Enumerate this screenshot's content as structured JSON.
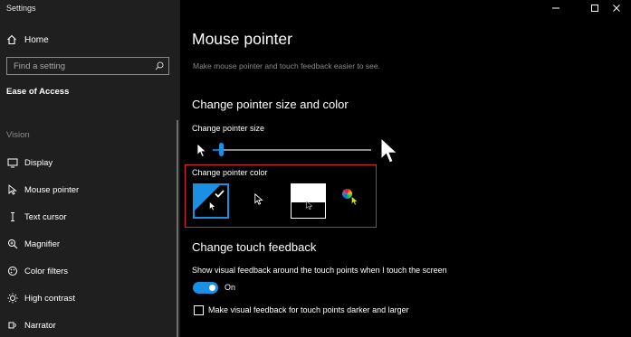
{
  "window": {
    "title": "Settings",
    "controls": [
      "minimize",
      "maximize",
      "close"
    ]
  },
  "sidebar": {
    "home_label": "Home",
    "search": {
      "placeholder": "Find a setting",
      "value": ""
    },
    "section_title": "Ease of Access",
    "group_label": "Vision",
    "items": [
      {
        "label": "Display",
        "icon": "display-icon"
      },
      {
        "label": "Mouse pointer",
        "icon": "mouse-pointer-icon"
      },
      {
        "label": "Text cursor",
        "icon": "text-cursor-icon"
      },
      {
        "label": "Magnifier",
        "icon": "magnifier-icon"
      },
      {
        "label": "Color filters",
        "icon": "color-filters-icon"
      },
      {
        "label": "High contrast",
        "icon": "high-contrast-icon"
      },
      {
        "label": "Narrator",
        "icon": "narrator-icon"
      }
    ]
  },
  "main": {
    "title": "Mouse pointer",
    "subtitle": "Make mouse pointer and touch feedback easier to see.",
    "size_color_heading": "Change pointer size and color",
    "pointer_size_label": "Change pointer size",
    "pointer_size_level": 0.05,
    "pointer_color_label": "Change pointer color",
    "pointer_color_options": [
      "white",
      "black",
      "inverted",
      "custom"
    ],
    "pointer_color_selected": "white",
    "touch_heading": "Change touch feedback",
    "touch_desc": "Show visual feedback around the touch points when I touch the screen",
    "toggle_state": "On",
    "darker_checkbox_label": "Make visual feedback for touch points darker and larger",
    "darker_checked": false
  },
  "colors": {
    "accent": "#1a8fe3",
    "highlight": "#e0242b",
    "sidebar_bg": "#1f1f1f",
    "main_bg": "#000000"
  }
}
